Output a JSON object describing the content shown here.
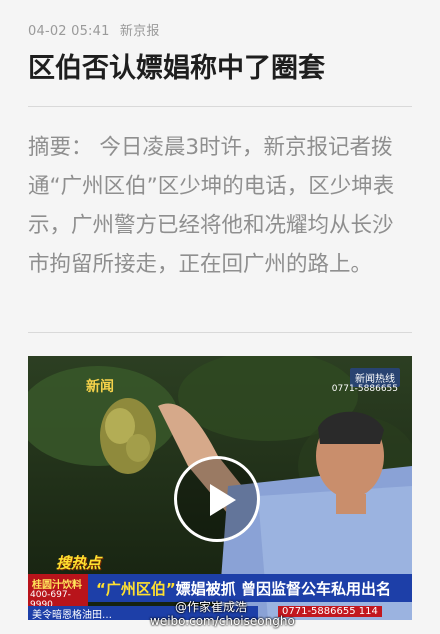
{
  "article": {
    "date": "04-02 05:41",
    "source": "新京报",
    "title": "区伯否认嫖娼称中了圈套",
    "summary": "摘要： 今日凌晨3时许，新京报记者拨通“广州区伯”区少坤的电话，区少坤表示，广州警方已经将他和冼耀均从长沙市拘留所接走，正在回广州的路上。"
  },
  "video": {
    "channel_logo_text": "新闻",
    "corner_tag": "新闻热线",
    "corner_phone": "0771-5886655",
    "hot_label": "搜热点",
    "ad_name": "桂圆汁饮料",
    "ad_phone": "400-697-9990",
    "headline_quoted": "“广州区伯”",
    "headline_rest": "嫖娼被抓 曾因监督公车私用出名",
    "bottom_phone": "0771-5886655 114",
    "bottom_ticker": "美令暗恩格油田…",
    "play_icon": "play-icon"
  },
  "watermark": {
    "handle": "@作家崔成浩",
    "url": "weibo.com/choiseongho"
  }
}
